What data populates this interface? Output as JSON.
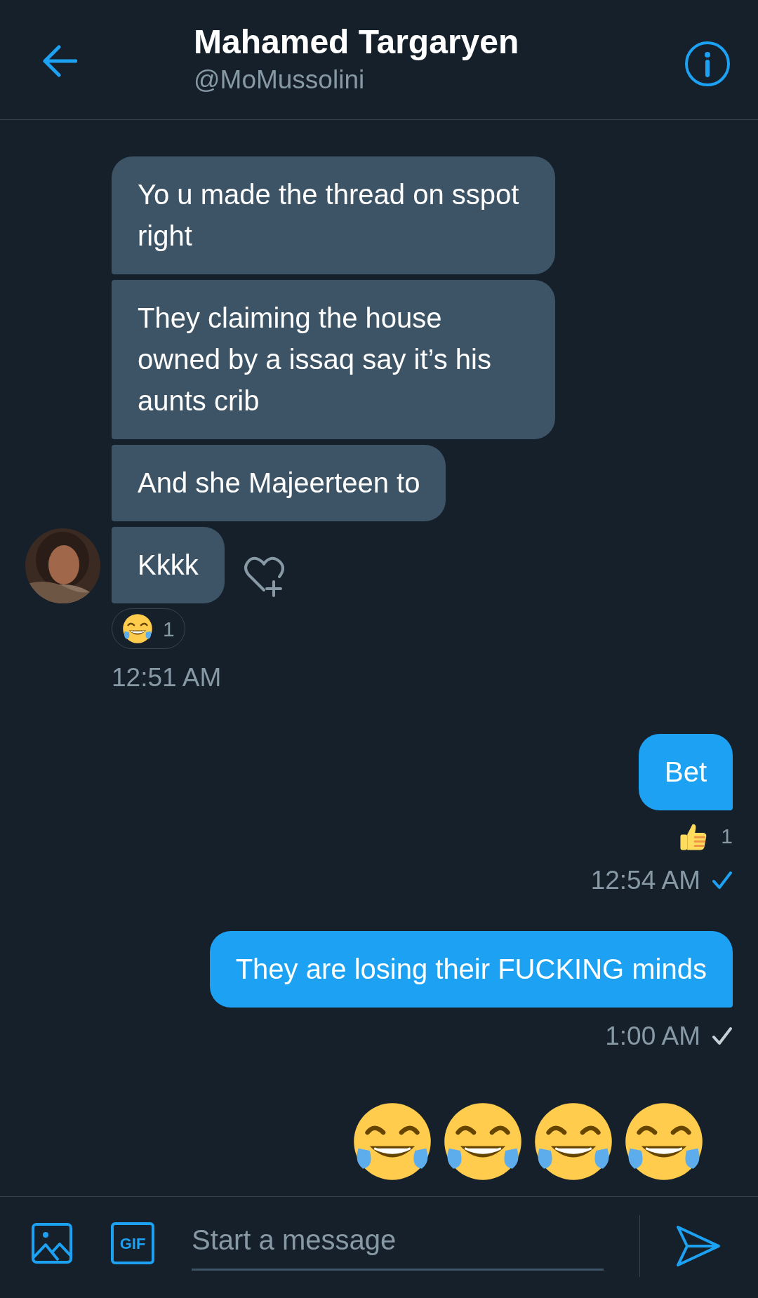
{
  "header": {
    "title": "Mahamed Targaryen",
    "handle": "@MoMussolini"
  },
  "messages": [
    {
      "kind": "received",
      "bubbles": [
        "Yo u made the thread on sspot right",
        "They claiming the house owned by a issaq say it’s his aunts crib",
        "And she Majeerteen to",
        "Kkkk"
      ],
      "reaction": {
        "kind": "laughing",
        "count": "1"
      },
      "time": "12:51 AM"
    },
    {
      "kind": "sent",
      "text": "Bet",
      "reaction": {
        "kind": "thumbs_up",
        "count": "1"
      },
      "time": "12:54 AM",
      "read": true
    },
    {
      "kind": "sent",
      "text": "They are losing their FUCKING minds",
      "time": "1:00 AM",
      "read": false
    },
    {
      "kind": "emoji",
      "emojis": [
        {
          "kind": "laughing"
        },
        {
          "kind": "laughing"
        },
        {
          "kind": "laughing"
        },
        {
          "kind": "laughing"
        }
      ]
    }
  ],
  "composer": {
    "placeholder": "Start a message",
    "gif_label": "GIF"
  }
}
